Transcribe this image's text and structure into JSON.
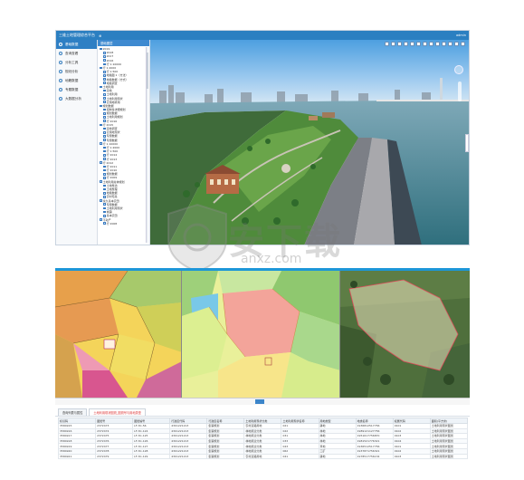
{
  "app1": {
    "title": "三维土地管理综合平台",
    "title_suffix": "⊕",
    "user": "admin",
    "nav": [
      {
        "label": "基础数据",
        "active": true
      },
      {
        "label": "查询查看",
        "active": false
      },
      {
        "label": "分析工具",
        "active": false
      },
      {
        "label": "规划分析",
        "active": false
      },
      {
        "label": "地籍数据",
        "active": false
      },
      {
        "label": "专题数据",
        "active": false
      },
      {
        "label": "大数据分析",
        "active": false
      }
    ],
    "tree_header": "基础图层",
    "tree": [
      "2019",
      "2018",
      "2017",
      "2016",
      "行 1:10000",
      "行 1:2000",
      "行 1:500",
      "地籍图 1（方法）",
      "地籍数据（方式）",
      "地籍调查",
      "土地利用",
      "宗地",
      "土地利用",
      "土地利用现状",
      "农用地转用",
      "规划数据",
      "控制性详细规划",
      "规划数据",
      "土地利用规划",
      "行 2016",
      "行 2015",
      "宗地调查",
      "农用地现状",
      "专题数据",
      "专题数据",
      "行 1:10000",
      "行 1:2000",
      "行 1:500",
      "行 2014",
      "行 2013",
      "行 2012",
      "行 2011",
      "行 2010",
      "规划数据",
      "行 2009",
      "土地利用总体规划",
      "土地整治",
      "土地整理",
      "地籍数据",
      "农村宅基",
      "永久基本农田",
      "专题数据",
      "土地利用现状",
      "城镇",
      "基本农田",
      "不动产",
      "行 2008"
    ]
  },
  "app2": {
    "tabs": [
      {
        "label": "查询列表与属性",
        "active": false
      },
      {
        "label": "土地利用现状图斑_图斑号与用地类型",
        "active": true
      }
    ],
    "table": {
      "headers": [
        "标识码",
        "图斑号",
        "图斑编号",
        "行政区代码",
        "行政区名称",
        "土地利用现状分类",
        "土地利用现状名称",
        "用地类型",
        "地类名称",
        "权属代码",
        "面积(平方米)",
        "权属性质",
        "权属单位名称"
      ],
      "rows": [
        [
          "3584915",
          "2372473",
          "LF-3C-56",
          "4301221213",
          "集镇规划",
          "农村道路用地",
          "021",
          "耕地",
          "1936812517756",
          "0101",
          "土地利用现状图斑"
        ],
        [
          "3584916",
          "2372474",
          "LF-3C-124",
          "4301221213",
          "集镇规划",
          "林地用途分类",
          "022",
          "林地",
          "1989121127756",
          "0102",
          "土地利用现状图斑"
        ],
        [
          "3584917",
          "2372475",
          "LF-3C-125",
          "4301221213",
          "集镇规划",
          "林地用途分类",
          "031",
          "林地",
          "1951617756870",
          "0103",
          "土地利用现状图斑"
        ],
        [
          "3584918",
          "2372476",
          "LF-3C-126",
          "4301221213",
          "集镇规划",
          "林地用途分类",
          "033",
          "林地",
          "1981521776321",
          "0104",
          "土地利用现状图斑"
        ],
        [
          "3584919",
          "2372477",
          "LF-3C-127",
          "4301221213",
          "集镇规划",
          "林地用途分类",
          "043",
          "草地",
          "1936512517756",
          "0101",
          "土地利用现状图斑"
        ],
        [
          "3584920",
          "2372478",
          "LF-3C-128",
          "4301221213",
          "集镇规划",
          "林地用途分类",
          "062",
          "工矿",
          "1937871756321",
          "0102",
          "土地利用现状图斑"
        ],
        [
          "3584921",
          "2372479",
          "LF-3C-129",
          "4301221213",
          "集镇规划",
          "农村道路用地",
          "041",
          "耕地",
          "1978517756134",
          "0103",
          "土地利用现状图斑"
        ]
      ]
    }
  },
  "watermark": {
    "big": "安下载",
    "small": "anxz.com"
  }
}
